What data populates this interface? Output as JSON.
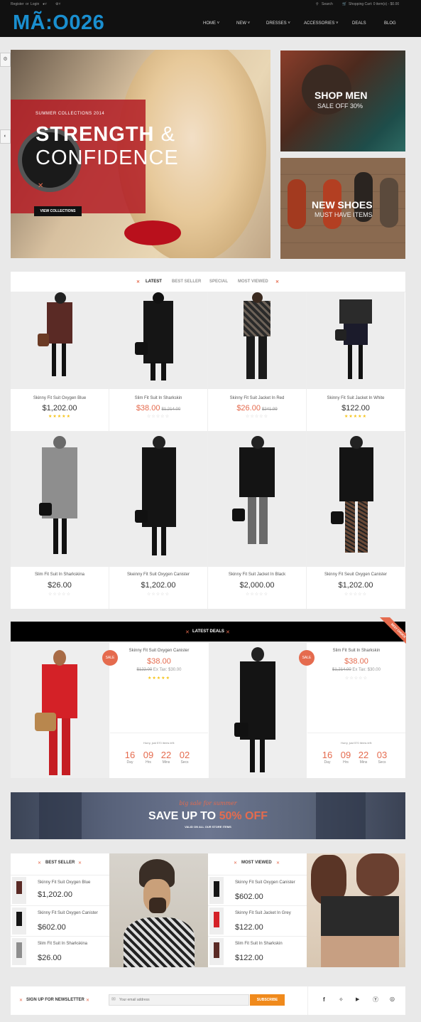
{
  "topbar": {
    "register": "Register",
    "or": "or",
    "login": "Login",
    "search": "Search",
    "cart": "Shopping Cart: 0 item(s) - $0.00"
  },
  "logo": "MÃ:O026",
  "nav": [
    "HOME",
    "NEW",
    "DRESSES",
    "ACCESSORIES",
    "DEALS",
    "BLOG"
  ],
  "hero": {
    "kicker": "SUMMER COLLECTIONS 2014",
    "headline1": "STRENGTH",
    "amp": "&",
    "headline2": "CONFIDENCE",
    "button": "VIEW COLLECTIONS"
  },
  "promos": [
    {
      "title": "SHOP MEN",
      "subtitle": "SALE OFF 30%"
    },
    {
      "title": "NEW SHOES",
      "subtitle": "MUST HAVE ITEMS"
    }
  ],
  "tabs": [
    "LATEST",
    "BEST SELLER",
    "SPECIAL",
    "MOST VIEWED"
  ],
  "products": [
    {
      "name": "Skinny Fit Suit Oxygen Blue",
      "price": "$1,202.00",
      "old": "",
      "rating": 5
    },
    {
      "name": "Slim Fit Suit In Sharkskin",
      "price": "$38.00",
      "old": "$1,214.00",
      "rating": 0
    },
    {
      "name": "Skinny Fit Suit Jacket In Red",
      "price": "$26.00",
      "old": "$241.99",
      "rating": 0
    },
    {
      "name": "Skinny Fit Suit Jacket In White",
      "price": "$122.00",
      "old": "",
      "rating": 5
    },
    {
      "name": "Slim Fit Suit In Sharkskina",
      "price": "$26.00",
      "old": "",
      "rating": 0
    },
    {
      "name": "Skeinny Fit Suit Oxygen Canister",
      "price": "$1,202.00",
      "old": "",
      "rating": 0
    },
    {
      "name": "Skinny Fit Suit Jacket In Black",
      "price": "$2,000.00",
      "old": "",
      "rating": 0
    },
    {
      "name": "Skinny Fit Seuit Oxygen Canister",
      "price": "$1,202.00",
      "old": "",
      "rating": 0
    }
  ],
  "deals": {
    "title": "LATEST DEALS",
    "ribbon": "BEST CHOICE",
    "items": [
      {
        "badge": "SALE",
        "name": "Skinny Fit Suit Oxygen Canister",
        "price": "$38.00",
        "old": "$122.00",
        "extax": "Ex Tax: $30.00",
        "rating": 5,
        "hurry": "Hurry, just 570 items left:",
        "countdown": [
          {
            "n": "16",
            "l": "Day"
          },
          {
            "n": "09",
            "l": "Hrs"
          },
          {
            "n": "22",
            "l": "Mins"
          },
          {
            "n": "02",
            "l": "Secs"
          }
        ]
      },
      {
        "badge": "SALE",
        "name": "Slim Fit Suit In Sharkskin",
        "price": "$38.00",
        "old": "$1,214.00",
        "extax": "Ex Tax: $30.00",
        "rating": 0,
        "hurry": "Hurry, just 570 items left:",
        "countdown": [
          {
            "n": "16",
            "l": "Day"
          },
          {
            "n": "09",
            "l": "Hrs"
          },
          {
            "n": "22",
            "l": "Mins"
          },
          {
            "n": "03",
            "l": "Secs"
          }
        ]
      }
    ]
  },
  "banner": {
    "script": "big sale for summer",
    "main": "SAVE UP TO",
    "percent": "50% OFF",
    "sub": "VALID ON ALL OUR STORE ITEMS"
  },
  "bestseller": {
    "title": "BEST SELLER",
    "items": [
      {
        "name": "Skinny Fit Suit Oxygen Blue",
        "price": "$1,202.00"
      },
      {
        "name": "Skinny Fit Suit Oxygen Canister",
        "price": "$602.00"
      },
      {
        "name": "Slim Fit Suit In Sharkskina",
        "price": "$26.00"
      }
    ]
  },
  "mostviewed": {
    "title": "MOST VIEWED",
    "items": [
      {
        "name": "Skinny Fit Suit Oxygen Canister",
        "price": "$602.00"
      },
      {
        "name": "Skinny Fit Suit Jacket In Grey",
        "price": "$122.00"
      },
      {
        "name": "Slim Fit Suit In Sharkskin",
        "price": "$122.00"
      }
    ]
  },
  "newsletter": {
    "label": "SIGN UP FOR NEWSLETTER",
    "placeholder": "Your email address",
    "button": "SUBSCRIBE"
  },
  "social": [
    "facebook-icon",
    "twitter-icon",
    "youtube-icon",
    "pinterest-icon",
    "dribbble-icon"
  ],
  "colors": {
    "accent": "#e56b4e",
    "logo": "#1a8fd0",
    "button": "#f08a1c",
    "star": "#f5c317"
  }
}
